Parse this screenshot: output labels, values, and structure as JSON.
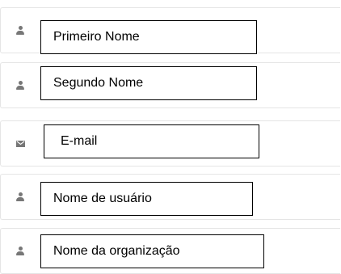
{
  "form": {
    "fields": [
      {
        "icon": "person-icon",
        "label": "Primeiro Nome"
      },
      {
        "icon": "person-icon",
        "label": "Segundo Nome"
      },
      {
        "icon": "envelope-icon",
        "label": "E-mail"
      },
      {
        "icon": "person-icon",
        "label": "Nome de usuário"
      },
      {
        "icon": "person-icon",
        "label": "Nome da organização"
      }
    ]
  }
}
